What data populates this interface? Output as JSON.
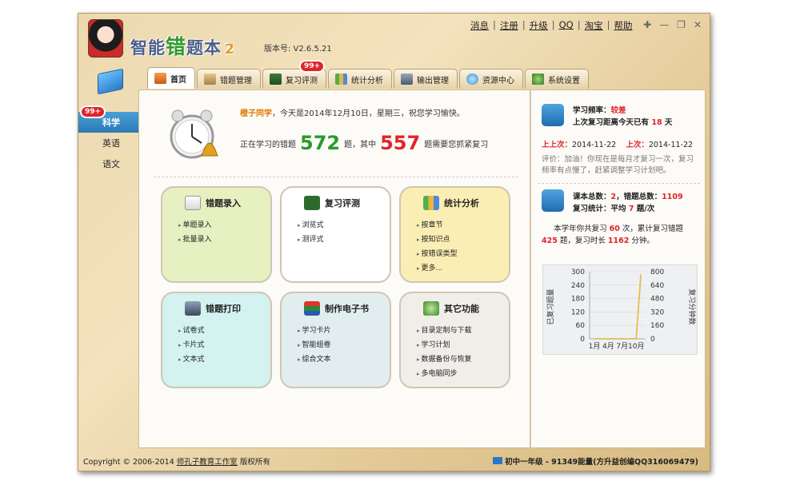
{
  "app": {
    "logo_main": "智能",
    "logo_highlight": "错",
    "logo_tail": "题本",
    "logo_num": "2",
    "version": "版本号: V2.6.5.21"
  },
  "toplinks": [
    "消息",
    "注册",
    "升级",
    "QQ",
    "淘宝",
    "帮助"
  ],
  "tabs": [
    {
      "label": "首页",
      "icon": "home-icon",
      "active": true
    },
    {
      "label": "错题管理",
      "icon": "clipboard-icon"
    },
    {
      "label": "复习评测",
      "icon": "abc-board-icon",
      "badge": "99+"
    },
    {
      "label": "统计分析",
      "icon": "bar-chart-icon"
    },
    {
      "label": "输出管理",
      "icon": "printer-icon"
    },
    {
      "label": "资源中心",
      "icon": "cloud-icon"
    },
    {
      "label": "系统设置",
      "icon": "settings-icon"
    }
  ],
  "subjects": {
    "badge": "99+",
    "items": [
      "科学",
      "英语",
      "语文"
    ]
  },
  "welcome": {
    "name": "橙子同学",
    "greeting": "，今天是2014年12月10日，星期三，祝您学习愉快。",
    "count_prefix": "正在学习的错题",
    "total": "572",
    "count_mid": "题，其中",
    "pending": "557",
    "count_suffix": "题需要您抓紧复习"
  },
  "cards": [
    {
      "title": "错题录入",
      "color": "#e6f0c0",
      "items": [
        "单题录入",
        "批量录入"
      ]
    },
    {
      "title": "复习评测",
      "color": "#ffffff",
      "items": [
        "浏览式",
        "测评式"
      ]
    },
    {
      "title": "统计分析",
      "color": "#fbeeb4",
      "items": [
        "按章节",
        "按知识点",
        "按错误类型",
        "更多..."
      ]
    },
    {
      "title": "错题打印",
      "color": "#d3f2f0",
      "items": [
        "试卷式",
        "卡片式",
        "文本式"
      ]
    },
    {
      "title": "制作电子书",
      "color": "#e2edf0",
      "items": [
        "学习卡片",
        "智能组卷",
        "综合文本"
      ]
    },
    {
      "title": "其它功能",
      "color": "#f1eeea",
      "items": [
        "目录定制与下载",
        "学习计划",
        "数据备份与恢复",
        "多电脑同步"
      ]
    }
  ],
  "right": {
    "freq_label": "学习频率：",
    "freq_value": "较差",
    "last_label": "上次复习距离今天已有",
    "last_days": "18",
    "days_unit": "天",
    "up_label": "上上次：",
    "up_date": "2014-11-22",
    "prev_label": "上次：",
    "prev_date": "2014-11-22",
    "comment": "评价：加油！你现在是每月才复习一次，复习频率有点慢了，赶紧调整学习计划吧。",
    "total_label": "课本总数：",
    "total_books": "2",
    "err_label": "，错题总数：",
    "err_total": "1109",
    "review_label": "复习统计：平均",
    "avg": "7",
    "avg_unit": "题/次",
    "year_p1": "本学年你共复习",
    "year_times": "60",
    "year_p2": "次，累计复习错题",
    "year_qs": "425",
    "year_p3": "题，复习时长",
    "year_min": "1162",
    "year_p4": "分钟。"
  },
  "chart_data": {
    "type": "line",
    "categories": [
      "1月",
      "4月",
      "7月",
      "10月"
    ],
    "ylabel": "已复习题量",
    "y2label": "复习分钟数",
    "ylim": [
      0,
      300
    ],
    "y2lim": [
      0,
      800
    ],
    "yticks": [
      "300",
      "240",
      "180",
      "120",
      "60",
      "0"
    ],
    "y2ticks": [
      "800",
      "640",
      "480",
      "320",
      "160",
      "0"
    ],
    "series": [
      {
        "values": [
          0,
          0,
          0,
          0,
          0,
          0,
          0,
          0,
          0,
          0,
          280
        ]
      },
      {
        "values": [
          0,
          0,
          0,
          0,
          0,
          0,
          0,
          0,
          0,
          0,
          290
        ]
      }
    ]
  },
  "status": {
    "copyright_pre": "Copyright © 2006-2014",
    "copyright_link": "师孔子教育工作室",
    "copyright_post": "版权所有",
    "right": "初中一年级 - 91349能量(方升益创编QQ316069479)"
  }
}
